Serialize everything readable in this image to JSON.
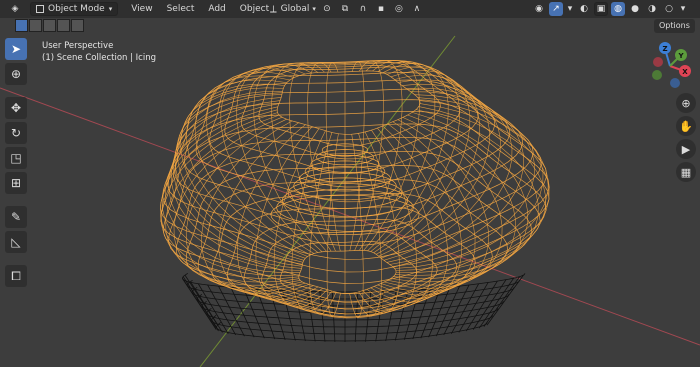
{
  "header": {
    "mode_label": "Object Mode",
    "menus": [
      "View",
      "Select",
      "Add",
      "Object"
    ],
    "transform_orientation": "Global"
  },
  "subheader": {
    "options_label": "Options"
  },
  "viewport": {
    "perspective_label": "User Perspective",
    "collection_label": "(1) Scene Collection | Icing"
  },
  "gizmo": {
    "axis_labels": {
      "x": "X",
      "y": "Y",
      "z": "Z"
    },
    "colors": {
      "x": "#e04455",
      "y": "#5c9c3c",
      "z": "#3c7fd6",
      "neg_x": "#9a3a44",
      "neg_y": "#4d7a36",
      "neg_z": "#3a5e92"
    }
  },
  "colors": {
    "wire_selected": "#f5a742",
    "wire_unselected": "#111111",
    "axis_x": "#b44b55",
    "axis_y": "#7a9a32",
    "accent": "#4772b3",
    "background": "#3d3d3d"
  },
  "icons": {
    "toolbar": [
      "select-box-icon",
      "cursor-icon",
      "move-icon",
      "rotate-icon",
      "scale-icon",
      "transform-icon",
      "annotate-icon",
      "measure-icon",
      "add-cube-icon"
    ],
    "navigation": [
      "zoom-icon",
      "hand-pan-icon",
      "camera-icon",
      "grid-icon"
    ]
  }
}
